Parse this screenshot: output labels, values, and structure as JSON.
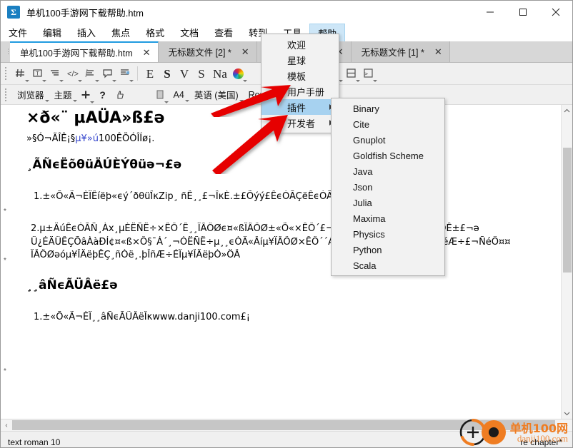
{
  "window": {
    "title": "单机100手游网下载帮助.htm",
    "icon": "app-logo-icon",
    "minimize": "−",
    "maximize": "□",
    "close": "✕"
  },
  "menubar": {
    "items": [
      {
        "label": "文件",
        "active": false
      },
      {
        "label": "编辑",
        "active": false
      },
      {
        "label": "插入",
        "active": false
      },
      {
        "label": "焦点",
        "active": false
      },
      {
        "label": "格式",
        "active": false
      },
      {
        "label": "文档",
        "active": false
      },
      {
        "label": "查看",
        "active": false
      },
      {
        "label": "转到",
        "active": false
      },
      {
        "label": "工具",
        "active": false
      },
      {
        "label": "帮助",
        "active": true
      }
    ]
  },
  "tabs": [
    {
      "label": "单机100手游网下载帮助.htm",
      "close": "✕",
      "active": true
    },
    {
      "label": "无标题文件 [2] *",
      "close": "✕",
      "active": false
    },
    {
      "label": "",
      "close": "✕",
      "active": false
    },
    {
      "label": "无标题文件 [1] *",
      "close": "✕",
      "active": false
    }
  ],
  "toolbar_main": {
    "buttons": [
      {
        "name": "grid-icon",
        "glyph": "#",
        "caret": true
      },
      {
        "name": "text-box-icon",
        "glyph": "⊡",
        "caret": true
      },
      {
        "name": "paragraph-align-icon",
        "glyph": "≡",
        "caret": true
      },
      {
        "name": "code-icon",
        "glyph": "</>",
        "caret": true
      },
      {
        "name": "list-icon",
        "glyph": "☰",
        "caret": true
      },
      {
        "name": "comment-icon",
        "glyph": "▭",
        "caret": true
      },
      {
        "name": "layout-icon",
        "glyph": "▤",
        "caret": true
      }
    ],
    "style_buttons": [
      {
        "name": "emphasis-icon",
        "glyph": "E"
      },
      {
        "name": "strong-icon",
        "glyph": "S"
      },
      {
        "name": "verbatim-icon",
        "glyph": "V"
      },
      {
        "name": "sans-icon",
        "glyph": "S"
      },
      {
        "name": "name-icon",
        "glyph": "Na"
      }
    ],
    "color_picker": {
      "name": "color-wheel-icon",
      "caret": true
    },
    "right_buttons": [
      {
        "name": "insert-link-icon",
        "glyph": "↳",
        "caret": true
      },
      {
        "name": "chain-link-icon",
        "glyph": "∞",
        "caret": true
      },
      {
        "name": "copy-icon",
        "glyph": "❐",
        "caret": true
      },
      {
        "name": "save-icon",
        "glyph": "▤",
        "caret": true
      },
      {
        "name": "console-icon",
        "glyph": "▣",
        "caret": true
      }
    ]
  },
  "toolbar_secondary": {
    "items": [
      {
        "name": "browser-dropdown",
        "label": "浏览器",
        "caret": true
      },
      {
        "name": "theme-dropdown",
        "label": "主题",
        "caret": true
      },
      {
        "name": "add-icon",
        "label": "✛",
        "caret": true,
        "icon": true
      },
      {
        "name": "help-icon",
        "label": "?",
        "caret": false,
        "icon": true
      },
      {
        "name": "thumbs-up-icon",
        "label": "👍",
        "caret": false,
        "icon": true
      },
      {
        "name": "page-icon",
        "label": "▯",
        "caret": true,
        "icon": true
      },
      {
        "name": "paper-size-dropdown",
        "label": "A4",
        "caret": true
      },
      {
        "name": "language-dropdown",
        "label": "英语 (美国)",
        "caret": true
      },
      {
        "name": "font-dropdown",
        "label": "Roman",
        "caret": true
      }
    ]
  },
  "help_menu": {
    "items": [
      {
        "label": "欢迎",
        "submenu": false,
        "highlight": false
      },
      {
        "label": "星球",
        "submenu": false,
        "highlight": false
      },
      {
        "label": "模板",
        "submenu": false,
        "highlight": false
      },
      {
        "label": "用户手册",
        "submenu": false,
        "highlight": false
      },
      {
        "label": "插件",
        "submenu": true,
        "highlight": true
      },
      {
        "label": "开发者",
        "submenu": true,
        "highlight": false
      }
    ]
  },
  "plugin_menu": {
    "items": [
      {
        "label": "Binary"
      },
      {
        "label": "Cite"
      },
      {
        "label": "Gnuplot"
      },
      {
        "label": "Goldfish Scheme"
      },
      {
        "label": "Java"
      },
      {
        "label": "Json"
      },
      {
        "label": "Julia"
      },
      {
        "label": "Maxima"
      },
      {
        "label": "Physics"
      },
      {
        "label": "Python"
      },
      {
        "label": "Scala"
      }
    ]
  },
  "document": {
    "heading1": "×ð«¨ µAÜA»ß£ə",
    "para1_pre": "»§Ó¬ÃÎÊ¡§",
    "para1_blue": "µ¥»ú",
    "para1_post": "100ÊÖÓÎÍø¡.",
    "heading2a": "¸ÃÑϵËõθüÄÚÈÝθüə¬£ə",
    "item1": "1.±«Õ«Ä¬ÈÏÊíëþ«ϵý´ðθüÎ̇κZip¸ ñÊ¸¸£¬ÎκÈ.±£Õýý£ÊϵÓÃÇëÊϵÓÃÇëÊϵÈïëþ¡£",
    "item2_line1": "2.µ±ÄúÊϵÓÃÑ¸Àx¸µÈËÑË÷×ÊÔ´Ê¸¸ÏÂÔØϵ¤«ßÏÂÔØ±«Õ«×ÊÔ´£¬.¢ÏÖMD5Ö¸µÑéÖ¤¤ÿ»§ÔÊ±£¬ə",
    "item2_line2": "Ü¿ÉÄÜÊÇÕâÀàÐÍ¢¤«ß×Ô§¯Á´¸¬ÓËÑË÷µ¸¸ϵÒÄ«Âíµ¥ÏÂÔØ×ÊÔ´´ÁË£¬¨¨ÒϵÊϵÓÃMD5Ð£ÑéÆ÷£¬ÑéÖ¤¤",
    "item2_line3": "ÏÂÔØəóµ¥ÎÄëþÊÇ¸ñÓë¸.þÎñÆ÷ÉÏµ¥ÎÄëþÒ»ÖÂ",
    "heading2b": "¸¸âÑϵÃÜÂë£ə",
    "item3": "1.±«Õ«Ä¬ÈÏ¸¸âÑϵÃÜÂëÎκwww.danji100.com£¡"
  },
  "statusbar": {
    "left": "text roman 10",
    "right": "re chapter*"
  },
  "watermark": {
    "brand_cn": "单机100网",
    "brand_url": "danji100.com",
    "logo": "circle-plus-logo-icon"
  },
  "colors": {
    "accent_blue": "#1f9ae0",
    "menu_highlight": "#a7d2f0",
    "menu_active_bg": "#cde6f7",
    "watermark_orange": "#ef7d22",
    "arrow_red": "#e60000"
  }
}
